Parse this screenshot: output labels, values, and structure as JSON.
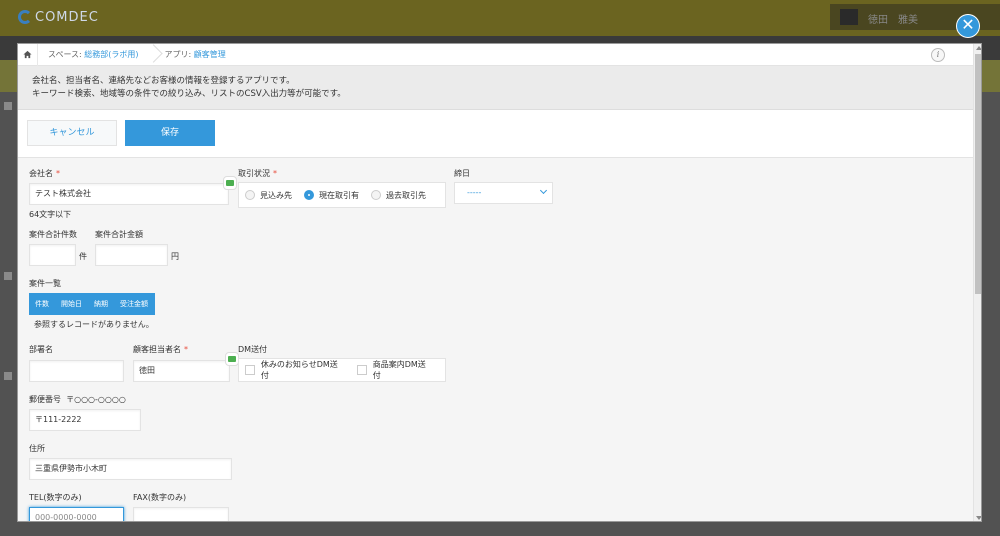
{
  "app": {
    "logo": "COMDEC",
    "user_name": "徳田　雅美"
  },
  "breadcrumb": {
    "space_label": "スペース:",
    "space_name": "総務部(ラボ用)",
    "app_label": "アプリ:",
    "app_name": "顧客管理"
  },
  "description": {
    "line1": "会社名、担当者名、連絡先などお客様の情報を登録するアプリです。",
    "line2": "キーワード検索、地域等の条件での絞り込み、リストのCSV入出力等が可能です。"
  },
  "toolbar": {
    "cancel_label": "キャンセル",
    "save_label": "保存"
  },
  "form": {
    "company": {
      "label": "会社名",
      "required": "*",
      "value": "テスト株式会社",
      "hint": "64文字以下"
    },
    "status": {
      "label": "取引状況",
      "required": "*",
      "options": [
        "見込み先",
        "現在取引有",
        "過去取引先"
      ],
      "selected": "現在取引有"
    },
    "closing_day": {
      "label": "締日",
      "value": "-----"
    },
    "case_count": {
      "label": "案件合計件数",
      "unit": "件",
      "value": ""
    },
    "case_amount": {
      "label": "案件合計金額",
      "unit": "円",
      "value": ""
    },
    "case_list": {
      "label": "案件一覧",
      "columns": [
        "件数",
        "開始日",
        "納期",
        "受注金額"
      ],
      "empty_text": "参照するレコードがありません。"
    },
    "department": {
      "label": "部署名",
      "value": ""
    },
    "contact": {
      "label": "顧客担当者名",
      "required": "*",
      "value": "徳田"
    },
    "dm": {
      "label": "DM送付",
      "options": [
        "休みのお知らせDM送付",
        "商品案内DM送付"
      ]
    },
    "postal": {
      "label": "郵便番号",
      "hint": "〒○○○-○○○○",
      "value": "〒111-2222"
    },
    "address": {
      "label": "住所",
      "value": "三重県伊勢市小木町"
    },
    "tel": {
      "label": "TEL(数字のみ)",
      "value": "000-0000-0000"
    },
    "fax": {
      "label": "FAX(数字のみ)",
      "value": ""
    }
  }
}
